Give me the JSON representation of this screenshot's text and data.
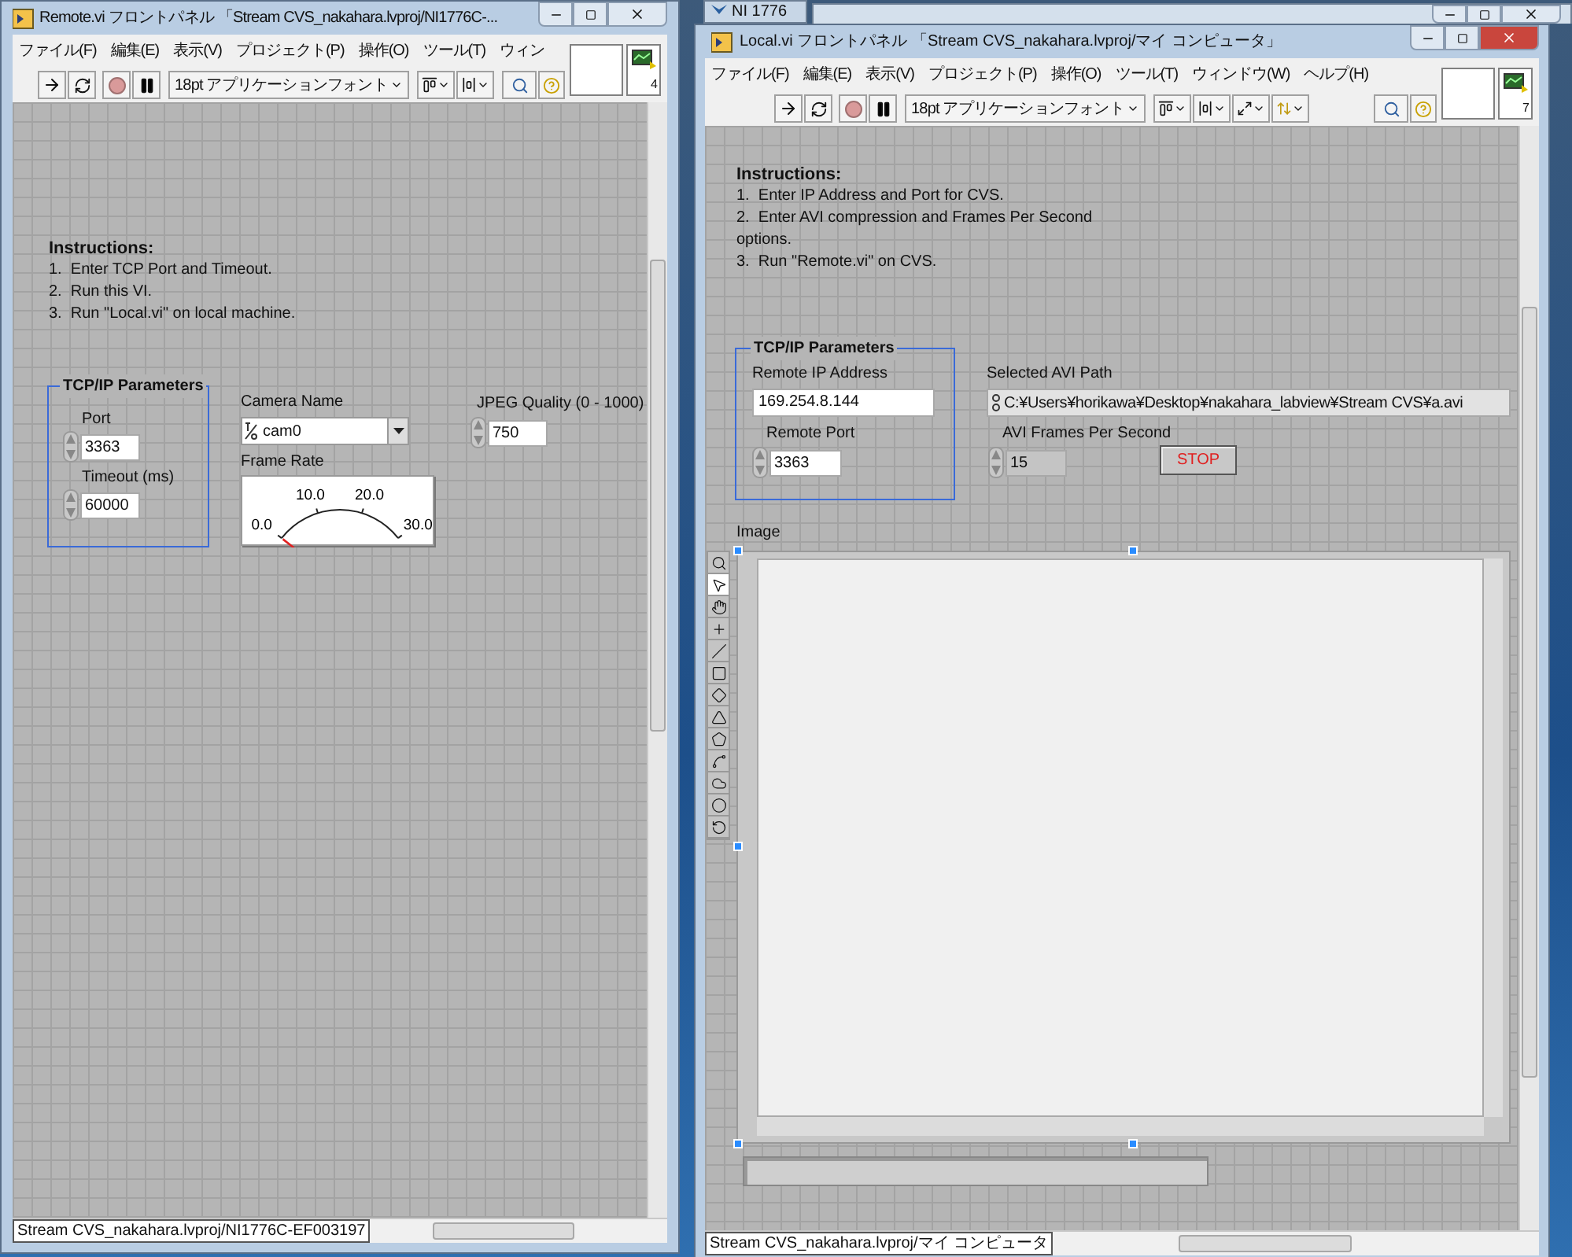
{
  "background_windows": [
    {
      "title": "NI 1776"
    },
    {
      "kind": "window"
    }
  ],
  "remote": {
    "title": "Remote.vi フロントパネル 「Stream CVS_nakahara.lvproj/NI1776C-...",
    "menu": [
      "ファイル(F)",
      "編集(E)",
      "表示(V)",
      "プロジェクト(P)",
      "操作(O)",
      "ツール(T)",
      "ウィン"
    ],
    "toolbar": [
      {
        "kind": "run"
      },
      {
        "kind": "run_continuously"
      },
      {
        "kind": "abort"
      },
      {
        "kind": "pause"
      },
      {
        "kind": "font",
        "label": "18pt アプリケーションフォント"
      },
      {
        "kind": "align"
      },
      {
        "kind": "distribute"
      },
      {
        "kind": "search"
      },
      {
        "kind": "help"
      }
    ],
    "connector_pane": "4",
    "instructions": {
      "heading": "Instructions:",
      "lines": [
        "1.  Enter TCP Port and Timeout.",
        "2.  Run this VI.",
        "3.  Run \"Local.vi\" on local machine."
      ]
    },
    "tcp_group": {
      "title": "TCP/IP Parameters",
      "port_label": "Port",
      "port": "3363",
      "timeout_label": "Timeout (ms)",
      "timeout": "60000"
    },
    "camera_name": {
      "label": "Camera Name",
      "value": "cam0"
    },
    "frame_rate": {
      "label": "Frame Rate",
      "ticks": [
        "0.0",
        "10.0",
        "20.0",
        "30.0"
      ],
      "level": 0
    },
    "jpeg_quality": {
      "label": "JPEG Quality (0 - 1000)",
      "value": "750"
    },
    "status": "Stream CVS_nakahara.lvproj/NI1776C-EF003197"
  },
  "local": {
    "title": "Local.vi フロントパネル 「Stream CVS_nakahara.lvproj/マイ コンピュータ」",
    "menu": [
      "ファイル(F)",
      "編集(E)",
      "表示(V)",
      "プロジェクト(P)",
      "操作(O)",
      "ツール(T)",
      "ウィンドウ(W)",
      "ヘルプ(H)"
    ],
    "toolbar": [
      {
        "kind": "run"
      },
      {
        "kind": "run_continuously"
      },
      {
        "kind": "abort"
      },
      {
        "kind": "pause"
      },
      {
        "kind": "font",
        "label": "18pt アプリケーションフォント"
      },
      {
        "kind": "align"
      },
      {
        "kind": "distribute"
      },
      {
        "kind": "resize"
      },
      {
        "kind": "reorder"
      },
      {
        "kind": "search"
      },
      {
        "kind": "help"
      }
    ],
    "connector_pane": "7",
    "instructions": {
      "heading": "Instructions:",
      "lines": [
        "1.  Enter IP Address and Port for CVS.",
        "2.  Enter AVI compression and Frames Per Second",
        "options.",
        "3.  Run \"Remote.vi\" on CVS."
      ]
    },
    "tcp_group": {
      "title": "TCP/IP Parameters",
      "ip_label": "Remote IP Address",
      "ip": "169.254.8.144",
      "port_label": "Remote Port",
      "port": "3363"
    },
    "avi_path": {
      "label": "Selected AVI Path",
      "value": "C:¥Users¥horikawa¥Desktop¥nakahara_labview¥Stream CVS¥a.avi"
    },
    "avi_fps": {
      "label": "AVI Frames Per Second",
      "value": "15",
      "disabled": true
    },
    "stop_button": {
      "label": "STOP"
    },
    "image": {
      "label": "Image",
      "tools": [
        {
          "kind": "zoom",
          "selected": false
        },
        {
          "kind": "pointer",
          "selected": true
        },
        {
          "kind": "pan",
          "selected": false
        },
        {
          "kind": "point",
          "selected": false
        },
        {
          "kind": "line",
          "selected": false
        },
        {
          "kind": "rectangle",
          "selected": false
        },
        {
          "kind": "rotated_rectangle",
          "selected": false
        },
        {
          "kind": "polygon",
          "selected": false
        },
        {
          "kind": "broken_line",
          "selected": false
        },
        {
          "kind": "freehand",
          "selected": false
        },
        {
          "kind": "freehand_region",
          "selected": false
        },
        {
          "kind": "oval",
          "selected": false
        },
        {
          "kind": "annulus",
          "selected": false
        }
      ]
    },
    "status": "Stream CVS_nakahara.lvproj/マイ コンピュータ"
  }
}
